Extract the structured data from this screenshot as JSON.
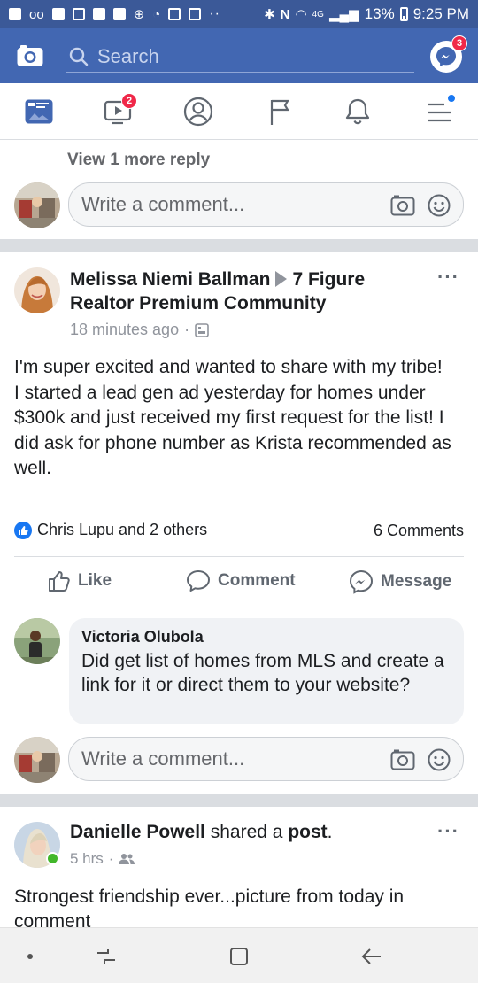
{
  "status_bar": {
    "battery": "13%",
    "time": "9:25 PM",
    "signal_label": "4G"
  },
  "top_bar": {
    "search_placeholder": "Search",
    "messenger_badge": "3"
  },
  "tab_bar": {
    "watch_badge": "2",
    "tabs": [
      "news-feed",
      "watch",
      "profile",
      "pages",
      "notifications",
      "menu"
    ]
  },
  "previous_post": {
    "view_more": "View 1 more reply",
    "comment_placeholder": "Write a comment..."
  },
  "post": {
    "author": "Melissa Niemi Ballman",
    "group": "7 Figure Realtor Premium Community",
    "timestamp": "18 minutes ago",
    "audience_icon": "group-icon",
    "body_lines": [
      "I'm super excited and wanted to share with my tribe!",
      "I started a lead gen ad yesterday for homes under $300k and just received my first request for the list! I did ask for phone number as Krista recommended as well."
    ],
    "reactions_text": "Chris Lupu and 2 others",
    "comments_count": "6 Comments",
    "actions": {
      "like": "Like",
      "comment": "Comment",
      "message": "Message"
    },
    "reply": {
      "name": "Victoria Olubola",
      "text": "Did get list of homes from MLS and create a link for it or direct them to your website?"
    },
    "comment_placeholder": "Write a comment..."
  },
  "post2": {
    "author": "Danielle Powell",
    "shared_text": "shared a",
    "post_word": "post",
    "period": ".",
    "timestamp": "5 hrs",
    "audience_icon": "friends-icon",
    "body": "Strongest friendship ever...picture from today in comment"
  },
  "colors": {
    "brand_blue": "#4267b2",
    "status_blue": "#3b5998",
    "badge_red": "#f02849",
    "link_blue": "#1877f2",
    "online_green": "#42b72a"
  }
}
